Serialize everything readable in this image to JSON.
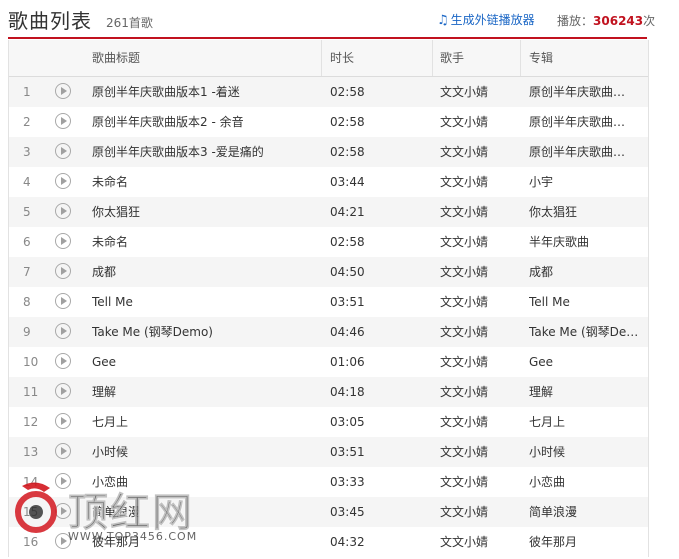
{
  "header": {
    "title": "歌曲列表",
    "song_count": "261首歌",
    "gen_player_label": "生成外链播放器",
    "plays_label": "播放：",
    "plays_count": "306243",
    "plays_unit": "次"
  },
  "columns": {
    "song_title": "歌曲标题",
    "duration": "时长",
    "artist": "歌手",
    "album": "专辑"
  },
  "songs": [
    {
      "idx": "1",
      "title": "原创半年庆歌曲版本1 -着迷",
      "duration": "02:58",
      "artist": "文文小婧",
      "album": "原创半年庆歌曲…"
    },
    {
      "idx": "2",
      "title": "原创半年庆歌曲版本2 - 余音",
      "duration": "02:58",
      "artist": "文文小婧",
      "album": "原创半年庆歌曲…"
    },
    {
      "idx": "3",
      "title": "原创半年庆歌曲版本3 -爱是痛的",
      "duration": "02:58",
      "artist": "文文小婧",
      "album": "原创半年庆歌曲…"
    },
    {
      "idx": "4",
      "title": "未命名",
      "duration": "03:44",
      "artist": "文文小婧",
      "album": "小宇"
    },
    {
      "idx": "5",
      "title": "你太猖狂",
      "duration": "04:21",
      "artist": "文文小婧",
      "album": "你太猖狂"
    },
    {
      "idx": "6",
      "title": "未命名",
      "duration": "02:58",
      "artist": "文文小婧",
      "album": "半年庆歌曲"
    },
    {
      "idx": "7",
      "title": "成都",
      "duration": "04:50",
      "artist": "文文小婧",
      "album": "成都"
    },
    {
      "idx": "8",
      "title": "Tell Me",
      "duration": "03:51",
      "artist": "文文小婧",
      "album": "Tell Me"
    },
    {
      "idx": "9",
      "title": "Take Me (钢琴Demo)",
      "duration": "04:46",
      "artist": "文文小婧",
      "album": "Take Me (钢琴De…"
    },
    {
      "idx": "10",
      "title": "Gee",
      "duration": "01:06",
      "artist": "文文小婧",
      "album": "Gee"
    },
    {
      "idx": "11",
      "title": "理解",
      "duration": "04:18",
      "artist": "文文小婧",
      "album": "理解"
    },
    {
      "idx": "12",
      "title": "七月上",
      "duration": "03:05",
      "artist": "文文小婧",
      "album": "七月上"
    },
    {
      "idx": "13",
      "title": "小时候",
      "duration": "03:51",
      "artist": "文文小婧",
      "album": "小时候"
    },
    {
      "idx": "14",
      "title": "小恋曲",
      "duration": "03:33",
      "artist": "文文小婧",
      "album": "小恋曲"
    },
    {
      "idx": "15",
      "title": "简单浪漫",
      "duration": "03:45",
      "artist": "文文小婧",
      "album": "简单浪漫"
    },
    {
      "idx": "16",
      "title": "彼年那月",
      "duration": "04:32",
      "artist": "文文小婧",
      "album": "彼年那月"
    }
  ],
  "watermark": {
    "brand": "顶红网",
    "url": "WWW.TOP3456.COM"
  },
  "colors": {
    "accent_red": "#c1121f",
    "link_blue": "#1a66c5",
    "stripe": "#f5f5f5"
  }
}
